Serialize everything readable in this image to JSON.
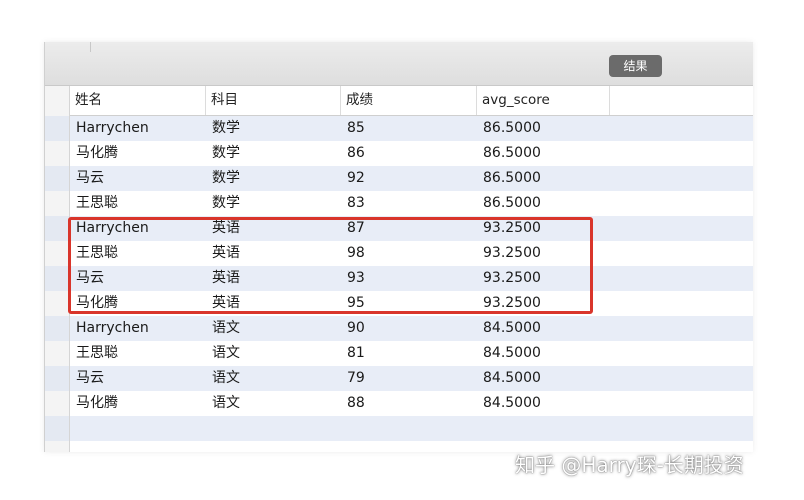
{
  "toolbar": {
    "result_tab_label": "结果"
  },
  "table": {
    "columns": [
      "姓名",
      "科目",
      "成绩",
      "avg_score"
    ],
    "rows": [
      [
        "Harrychen",
        "数学",
        "85",
        "86.5000"
      ],
      [
        "马化腾",
        "数学",
        "86",
        "86.5000"
      ],
      [
        "马云",
        "数学",
        "92",
        "86.5000"
      ],
      [
        "王思聪",
        "数学",
        "83",
        "86.5000"
      ],
      [
        "Harrychen",
        "英语",
        "87",
        "93.2500"
      ],
      [
        "王思聪",
        "英语",
        "98",
        "93.2500"
      ],
      [
        "马云",
        "英语",
        "93",
        "93.2500"
      ],
      [
        "马化腾",
        "英语",
        "95",
        "93.2500"
      ],
      [
        "Harrychen",
        "语文",
        "90",
        "84.5000"
      ],
      [
        "王思聪",
        "语文",
        "81",
        "84.5000"
      ],
      [
        "马云",
        "语文",
        "79",
        "84.5000"
      ],
      [
        "马化腾",
        "语文",
        "88",
        "84.5000"
      ]
    ]
  },
  "watermark": "知乎 @Harry琛-长期投资",
  "colors": {
    "stripe": "#e8edf7",
    "row": "#ffffff",
    "highlight_border": "#d9352b",
    "tab_bg": "#6b6b6b"
  }
}
